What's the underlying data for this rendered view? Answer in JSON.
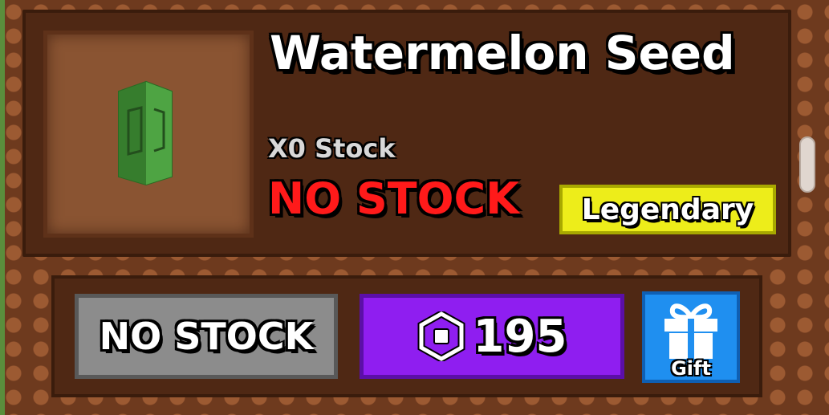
{
  "item": {
    "name": "Watermelon Seed",
    "stock_count": "X0 Stock",
    "stock_status": "NO STOCK",
    "rarity": "Legendary",
    "icon": "seed-packet-icon"
  },
  "actions": {
    "no_stock_label": "NO STOCK",
    "price": "195",
    "currency_icon": "robux-icon",
    "gift_label": "Gift",
    "gift_icon": "gift-icon"
  },
  "colors": {
    "no_stock_text": "#ff1a1a",
    "rarity_bg": "#eded1a",
    "buy_bg": "#8f1ef0",
    "gift_bg": "#1f8ff0",
    "disabled_bg": "#8c8c8c"
  }
}
